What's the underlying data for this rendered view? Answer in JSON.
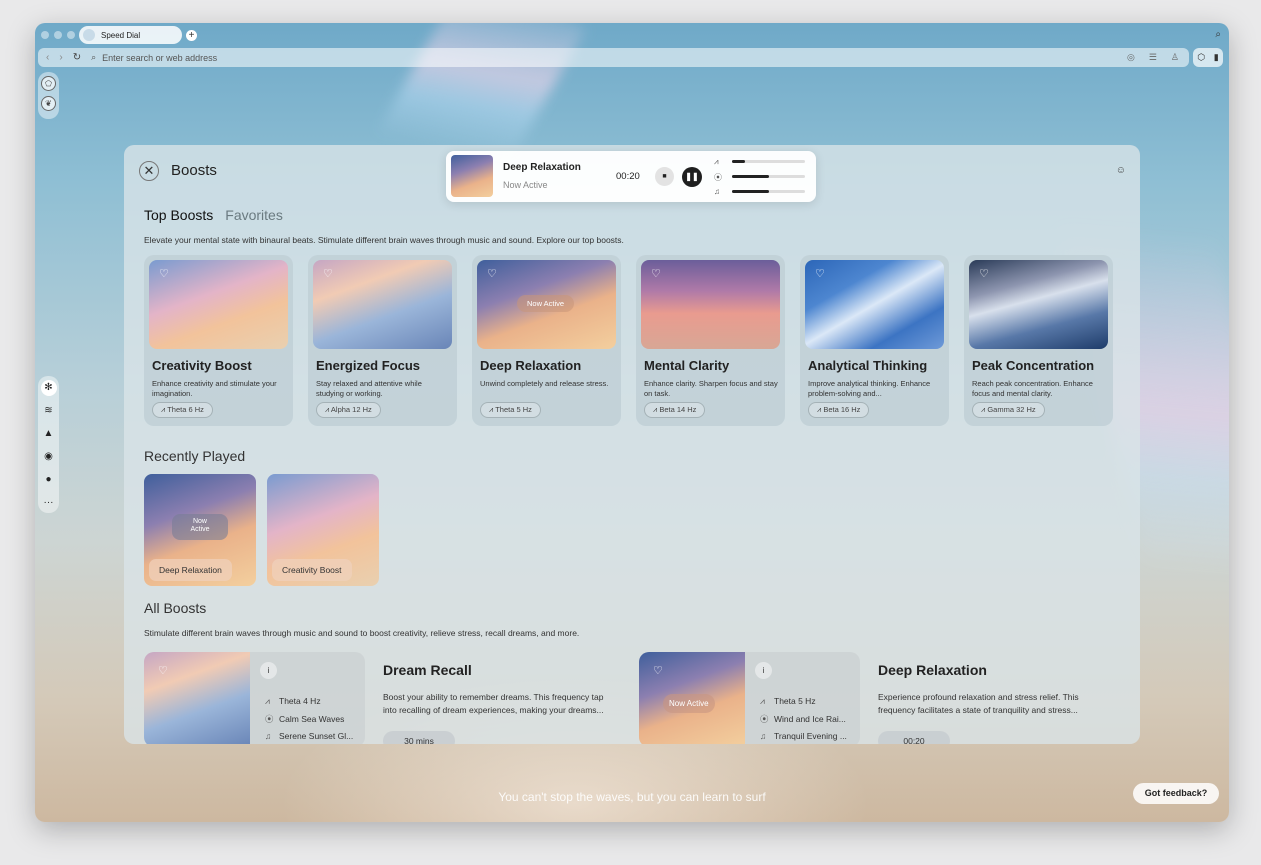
{
  "browser": {
    "tab_title": "Speed Dial",
    "new_tab": "+",
    "address_placeholder": "Enter search or web address"
  },
  "panel": {
    "title": "Boosts",
    "tabs": [
      {
        "label": "Top Boosts"
      },
      {
        "label": "Favorites"
      }
    ],
    "top_desc": "Elevate your mental state with binaural beats. Stimulate different brain waves through music and sound. Explore our top boosts.",
    "top_boosts": [
      {
        "name": "Creativity Boost",
        "desc": "Enhance creativity and stimulate your imagination.",
        "freq": "Theta 6 Hz",
        "active": ""
      },
      {
        "name": "Energized Focus",
        "desc": "Stay relaxed and attentive while studying or working.",
        "freq": "Alpha 12 Hz",
        "active": ""
      },
      {
        "name": "Deep Relaxation",
        "desc": "Unwind completely and release stress.",
        "freq": "Theta 5 Hz",
        "active": "Now Active"
      },
      {
        "name": "Mental Clarity",
        "desc": "Enhance clarity. Sharpen focus and stay on task.",
        "freq": "Beta 14 Hz",
        "active": ""
      },
      {
        "name": "Analytical Thinking",
        "desc": "Improve analytical thinking. Enhance problem-solving and...",
        "freq": "Beta 16 Hz",
        "active": ""
      },
      {
        "name": "Peak Concentration",
        "desc": "Reach peak concentration. Enhance focus and mental clarity.",
        "freq": "Gamma 32 Hz",
        "active": ""
      }
    ],
    "recent_title": "Recently Played",
    "recent": [
      {
        "label": "Deep Relaxation",
        "now_line1": "Now",
        "now_line2": "Active"
      },
      {
        "label": "Creativity Boost"
      }
    ],
    "all_title": "All Boosts",
    "all_desc": "Stimulate different brain waves through music and sound to boost creativity, relieve stress, recall dreams, and more.",
    "all_boosts": [
      {
        "name": "Dream Recall",
        "freq": "Theta 4 Hz",
        "sound": "Calm Sea Waves",
        "music": "Serene Sunset Gl...",
        "desc": "Boost your ability to remember dreams. This frequency tap into recalling of dream experiences, making your dreams...",
        "pill": "30 mins",
        "active": ""
      },
      {
        "name": "Deep Relaxation",
        "freq": "Theta 5 Hz",
        "sound": "Wind and Ice Rai...",
        "music": "Tranquil Evening ...",
        "desc": "Experience profound relaxation and stress relief. This frequency facilitates a state of tranquility and stress...",
        "pill": "00:20",
        "active": "Now Active"
      }
    ],
    "info_label": "i"
  },
  "player": {
    "title": "Deep Relaxation",
    "status": "Now Active",
    "time": "00:20",
    "levels": [
      0.18,
      0.5,
      0.5
    ]
  },
  "footer": {
    "quote": "You can't stop the waves, but you can learn to surf",
    "feedback": "Got feedback?"
  }
}
